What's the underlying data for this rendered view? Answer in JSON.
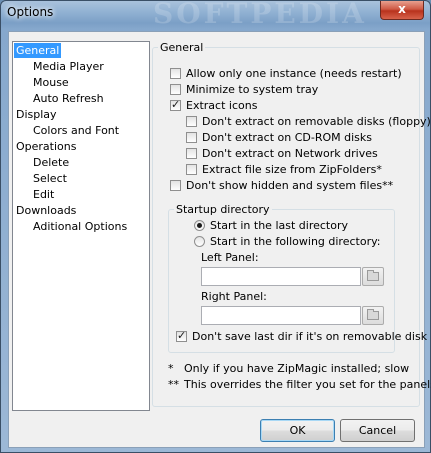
{
  "window": {
    "title": "Options",
    "watermark": "SOFTPEDIA",
    "close_label": "x"
  },
  "tree": {
    "items": [
      {
        "label": "General",
        "level": 0,
        "selected": true
      },
      {
        "label": "Media Player",
        "level": 1
      },
      {
        "label": "Mouse",
        "level": 1
      },
      {
        "label": "Auto Refresh",
        "level": 1
      },
      {
        "label": "Display",
        "level": 0
      },
      {
        "label": "Colors and Font",
        "level": 1
      },
      {
        "label": "Operations",
        "level": 0
      },
      {
        "label": "Delete",
        "level": 1
      },
      {
        "label": "Select",
        "level": 1
      },
      {
        "label": "Edit",
        "level": 1
      },
      {
        "label": "Downloads",
        "level": 0
      },
      {
        "label": "Aditional Options",
        "level": 1
      }
    ]
  },
  "general": {
    "legend": "General",
    "options": {
      "allow_one_instance": {
        "label": "Allow only one instance (needs restart)",
        "checked": false
      },
      "minimize_tray": {
        "label": "Minimize to system tray",
        "checked": false
      },
      "extract_icons": {
        "label": "Extract icons",
        "checked": true
      },
      "no_removable": {
        "label": "Don't extract on removable disks (floppy)",
        "checked": false
      },
      "no_cdrom": {
        "label": "Don't extract on CD-ROM disks",
        "checked": false
      },
      "no_network": {
        "label": "Don't extract on Network drives",
        "checked": false
      },
      "zipfolders": {
        "label": "Extract file size from ZipFolders*",
        "checked": false
      },
      "hidden_files": {
        "label": "Don't show hidden and system files**",
        "checked": false
      }
    },
    "startup": {
      "legend": "Startup directory",
      "last_dir": {
        "label": "Start in the last directory",
        "selected": true
      },
      "following_dir": {
        "label": "Start in the following directory:",
        "selected": false
      },
      "left_panel_label": "Left Panel:",
      "left_panel_value": "",
      "right_panel_label": "Right Panel:",
      "right_panel_value": "",
      "dont_save_removable": {
        "label": "Don't save last dir if it's on removable disk",
        "checked": true
      }
    },
    "notes": [
      {
        "mark": "*",
        "text": "Only if you have ZipMagic installed; slow"
      },
      {
        "mark": "**",
        "text": "This overrides the filter you set for the panels"
      }
    ]
  },
  "buttons": {
    "ok": "OK",
    "cancel": "Cancel"
  },
  "colors": {
    "selection": "#3399ff",
    "dialog_bg": "#f0f0f0",
    "titlebar": "#8fb0d2"
  }
}
